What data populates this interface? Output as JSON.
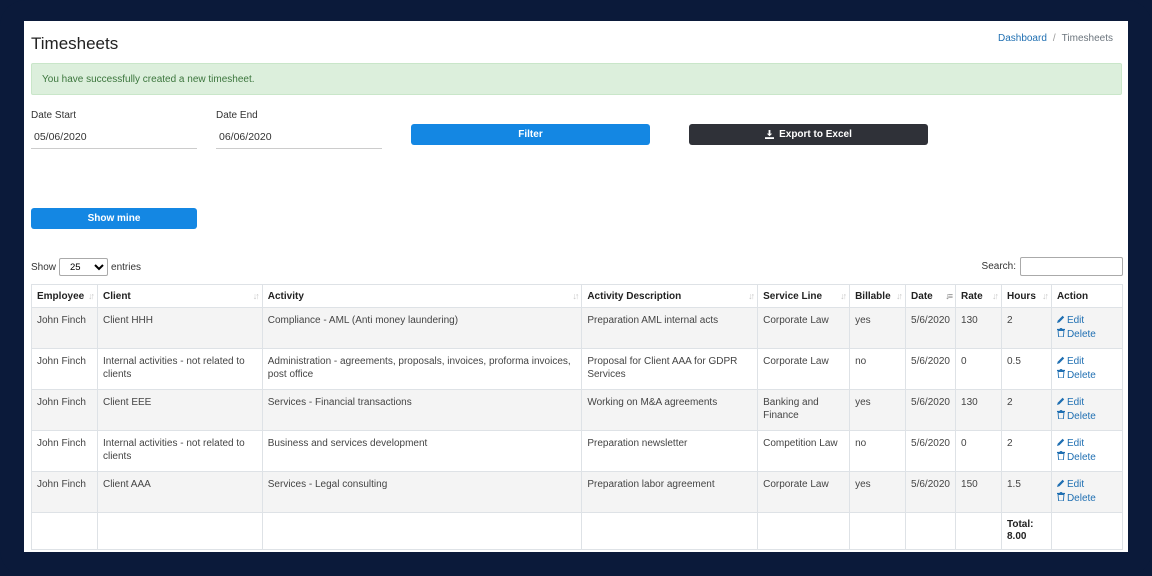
{
  "page": {
    "title": "Timesheets"
  },
  "breadcrumb": {
    "home": "Dashboard",
    "current": "Timesheets",
    "separator": "/"
  },
  "alert": {
    "message": "You have successfully created a new timesheet."
  },
  "filters": {
    "date_start_label": "Date Start",
    "date_start_value": "05/06/2020",
    "date_end_label": "Date End",
    "date_end_value": "06/06/2020",
    "filter_button": "Filter",
    "export_button": "Export to Excel",
    "show_mine_button": "Show mine"
  },
  "table_controls": {
    "show_label": "Show",
    "entries_label": "entries",
    "page_size": "25",
    "search_label": "Search:"
  },
  "table": {
    "headers": [
      "Employee",
      "Client",
      "Activity",
      "Activity Description",
      "Service Line",
      "Billable",
      "Date",
      "Rate",
      "Hours",
      "Action"
    ],
    "rows": [
      [
        "John Finch",
        "Client HHH",
        "Compliance - AML (Anti money laundering)",
        "Preparation AML internal acts",
        "Corporate Law",
        "yes",
        "5/6/2020",
        "130",
        "2"
      ],
      [
        "John Finch",
        "Internal activities - not related to clients",
        "Administration - agreements, proposals, invoices, proforma invoices, post office",
        "Proposal for Client AAA for GDPR Services",
        "Corporate Law",
        "no",
        "5/6/2020",
        "0",
        "0.5"
      ],
      [
        "John Finch",
        "Client EEE",
        "Services - Financial transactions",
        "Working on M&A agreements",
        "Banking and Finance",
        "yes",
        "5/6/2020",
        "130",
        "2"
      ],
      [
        "John Finch",
        "Internal activities - not related to clients",
        "Business and services development",
        "Preparation newsletter",
        "Competition Law",
        "no",
        "5/6/2020",
        "0",
        "2"
      ],
      [
        "John Finch",
        "Client AAA",
        "Services - Legal consulting",
        "Preparation labor agreement",
        "Corporate Law",
        "yes",
        "5/6/2020",
        "150",
        "1.5"
      ]
    ],
    "edit_label": "Edit",
    "delete_label": "Delete",
    "total_label": "Total:",
    "total_value": "8.00"
  },
  "colors": {
    "primary": "#1487e3",
    "dark": "#2f3138",
    "success_bg": "#dcefdc",
    "frame": "#0b1a3a"
  },
  "icons": {
    "export": "download-icon",
    "edit": "pencil-icon",
    "delete": "trash-icon",
    "sort": "sort-arrows-icon"
  }
}
